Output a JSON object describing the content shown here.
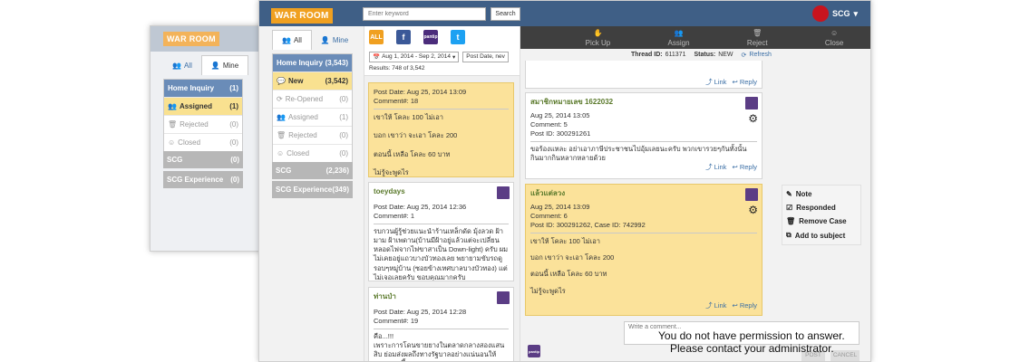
{
  "app": {
    "logo": "WAR ROOM",
    "search_placeholder": "Enter keyword",
    "search_btn": "Search",
    "user": "SCG"
  },
  "tabs": {
    "all": "All",
    "mine": "Mine"
  },
  "back": {
    "groups": [
      {
        "label": "Home Inquiry",
        "count": "(1)"
      }
    ],
    "rows": [
      {
        "label": "Assigned",
        "count": "(1)",
        "icon": "users-icon"
      },
      {
        "label": "Rejected",
        "count": "(0)",
        "icon": "trash-icon"
      },
      {
        "label": "Closed",
        "count": "(0)",
        "icon": "smile-icon"
      }
    ],
    "extra": [
      {
        "label": "SCG",
        "count": "(0)"
      },
      {
        "label": "SCG Experience",
        "count": "(0)"
      }
    ]
  },
  "front": {
    "group": {
      "label": "Home Inquiry",
      "count": "(3,543)"
    },
    "rows": [
      {
        "label": "New",
        "count": "(3,542)",
        "icon": "chat-icon",
        "sel": true
      },
      {
        "label": "Re-Opened",
        "count": "(0)",
        "icon": "refresh-icon",
        "sel": false
      },
      {
        "label": "Assigned",
        "count": "(1)",
        "icon": "users-icon",
        "sel": false
      },
      {
        "label": "Rejected",
        "count": "(0)",
        "icon": "trash-icon",
        "sel": false
      },
      {
        "label": "Closed",
        "count": "(0)",
        "icon": "smile-icon",
        "sel": false
      }
    ],
    "extra": [
      {
        "label": "SCG",
        "count": "(2,236)"
      },
      {
        "label": "SCG Experience",
        "count": "(349)"
      }
    ]
  },
  "filters": {
    "all_label": "ALL",
    "date_range": "Aug 1, 2014 - Sep 2, 2014",
    "sort": "Post Date, nev",
    "results": "Results: 748 of 3,542"
  },
  "actions": [
    {
      "label": "Pick Up",
      "icon": "hand-icon"
    },
    {
      "label": "Assign",
      "icon": "users-icon"
    },
    {
      "label": "Reject",
      "icon": "trash-icon"
    },
    {
      "label": "Close",
      "icon": "smile-icon"
    }
  ],
  "thread": {
    "id_label": "Thread ID:",
    "id": "611371",
    "status_label": "Status:",
    "status": "NEW",
    "refresh": "Refresh"
  },
  "feed": [
    {
      "name": "",
      "date": "Post Date: Aug 25, 2014 13:09",
      "comment": "Comment#: 18",
      "body": [
        "เขาให้ โคละ 100  ไม่เอา",
        "บอก เขาว่า จะเอา โคละ 200",
        "ตอนนี้ เหลือ โคละ 60 บาท",
        " ไม่รู้จะพูดไร"
      ]
    },
    {
      "name": "toeydays",
      "date": "Post Date: Aug 25, 2014 12:36",
      "comment": "Comment#: 1",
      "body": [
        "รบกวนผู้รู้ช่วยแนะนำร้านเหล็กดัด มุ้งลวด ฝ้ามาม ฝ้าเพดาน(บ้านมีฝ้าอยู่แล้วแต่จะเปลี่ยนหลอดไฟจากไฟขาสาเป็น Down-light)  ครับ ผมไม่เคยอยู่แถวบางบัวทองเลย  พยายามขับรถดูรอบๆหมู่บ้าน (ซอยข้างเทศบาลบางบัวทอง) แต่ไม่เจอเลยครับ ขอบคุณมากครับ"
      ]
    },
    {
      "name": "ท่านป่า",
      "date": "Post Date: Aug 25, 2014 12:28",
      "comment": "Comment#: 19",
      "body": [
        "คือ...!!!",
        "เพราะการโดนขายยางในตลาดกลางสองแสนสิบ ย่อมส่งผลถึงทางรัฐบาลอย่างแน่นอนให้ราคายางขึ้น"
      ]
    }
  ],
  "detail": [
    {
      "name": "สมาชิกหมายเลข 1622032",
      "date": "Aug 25, 2014 13:05",
      "comment": "Comment: 5",
      "post": "Post ID: 300291261",
      "body": [
        "ขอร้องแหละ อย่าเอาภาษีประชาชนไปอุ้มเลยนะครับ พวกเขารวยๆกันทั้งนั้น กินมากกินหลากหลายด้วย"
      ]
    },
    {
      "name": "แล้วแต่ลวง",
      "date": "Aug 25, 2014 13:09",
      "comment": "Comment: 6",
      "post": "Post ID: 300291262, Case ID: 742992",
      "body": [
        "เขาให้ โคละ 100  ไม่เอา",
        "บอก เขาว่า จะเอา โคละ 200",
        "ตอนนี้ เหลือ โคละ 60 บาท",
        " ไม่รู้จะพูดไร"
      ]
    }
  ],
  "link_label": "Link",
  "reply_label": "Reply",
  "side_menu": [
    {
      "label": "Note",
      "icon": "note-icon"
    },
    {
      "label": "Responded",
      "icon": "check-icon"
    },
    {
      "label": "Remove Case",
      "icon": "trash-icon"
    },
    {
      "label": "Add to subject",
      "icon": "link-icon"
    }
  ],
  "reply_box": {
    "placeholder": "Write a comment...",
    "post": "POST",
    "cancel": "CANCEL",
    "notice1": "You do not have permission to answer.",
    "notice2": "Please contact your administrator."
  }
}
